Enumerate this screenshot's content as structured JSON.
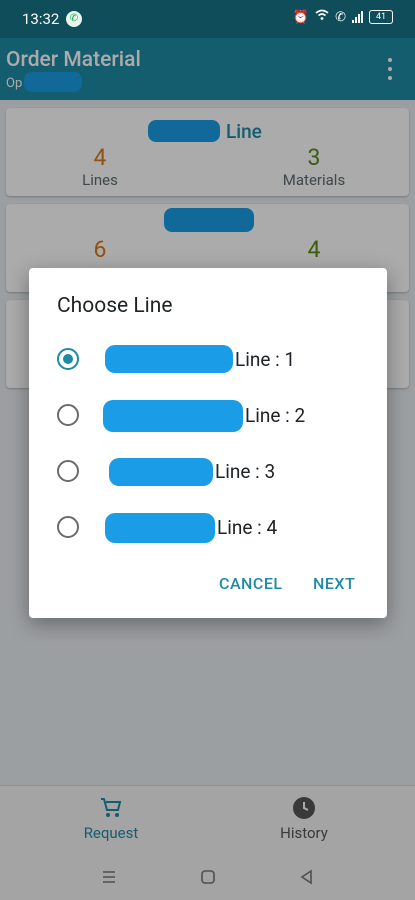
{
  "status_bar": {
    "time": "13:32",
    "battery": "41",
    "icons": [
      "whatsapp-icon",
      "alarm-icon",
      "wifi-icon",
      "wifi-calling-icon",
      "signal-icon",
      "battery-icon"
    ]
  },
  "app_bar": {
    "title": "Order Material",
    "subtitle": "Op"
  },
  "cards": [
    {
      "title": "Line",
      "stats": [
        {
          "value": "4",
          "label": "Lines"
        },
        {
          "value": "3",
          "label": "Materials"
        }
      ]
    },
    {
      "stats": [
        {
          "value": "6"
        },
        {
          "value": "4"
        }
      ]
    }
  ],
  "dialog": {
    "title": "Choose Line",
    "options": [
      {
        "label": "Line : 1",
        "selected": true
      },
      {
        "label": "Line : 2",
        "selected": false
      },
      {
        "label": "Line : 3",
        "selected": false
      },
      {
        "label": "Line : 4",
        "selected": false
      }
    ],
    "cancel_label": "CANCEL",
    "next_label": "NEXT"
  },
  "bottom_nav": {
    "items": [
      {
        "label": "Request",
        "icon": "cart-icon",
        "active": true
      },
      {
        "label": "History",
        "icon": "clock-icon",
        "active": false
      }
    ]
  },
  "system_nav": [
    "menu-icon",
    "home-icon",
    "back-icon"
  ],
  "colors": {
    "primary": "#1e8ba5",
    "status_bar": "#0f4d5a",
    "orange_number": "#d87a1a",
    "green_number": "#5a8a1a",
    "redaction": "#1a9de6"
  }
}
